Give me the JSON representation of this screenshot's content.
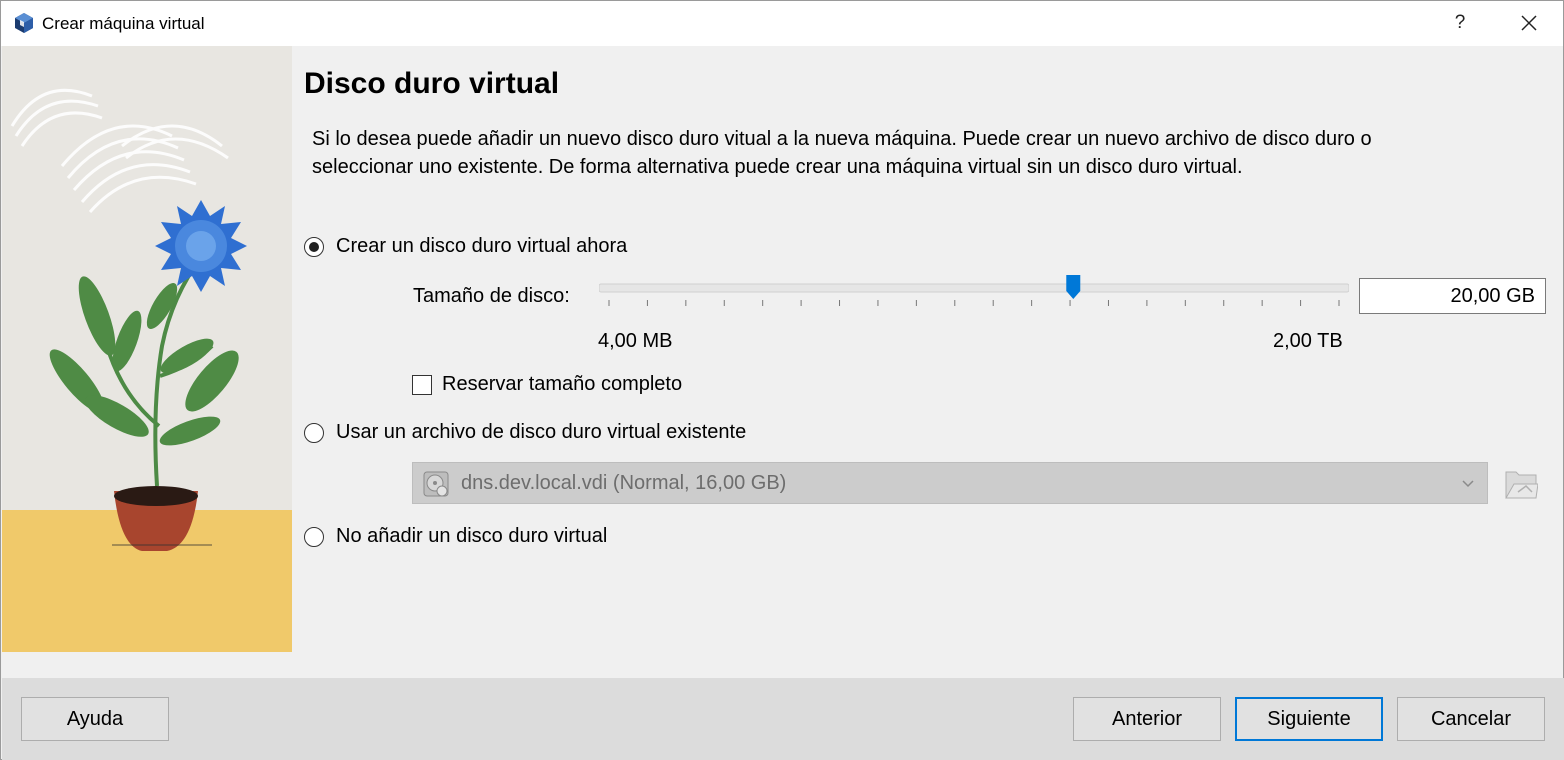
{
  "window": {
    "title": "Crear máquina virtual",
    "help": "?",
    "accent_color": "#0078d7"
  },
  "page": {
    "heading": "Disco duro virtual",
    "description": "Si lo desea puede añadir un nuevo disco duro vitual a la nueva máquina. Puede crear un nuevo archivo de disco duro o seleccionar uno existente. De forma alternativa puede crear una máquina virtual sin un disco duro virtual."
  },
  "options": {
    "create_now": {
      "label": "Crear un disco duro virtual ahora",
      "checked": true
    },
    "use_existing": {
      "label": "Usar un archivo de disco duro virtual existente",
      "checked": false
    },
    "no_disk": {
      "label": "No añadir un disco duro virtual",
      "checked": false
    }
  },
  "disk_size": {
    "label": "Tamaño de disco:",
    "value": "20,00 GB",
    "min_label": "4,00 MB",
    "max_label": "2,00 TB",
    "slider_fraction": 0.636,
    "tick_count": 20
  },
  "reserve": {
    "label": "Reservar tamaño completo",
    "checked": false
  },
  "existing_file": {
    "selected": "dns.dev.local.vdi (Normal, 16,00 GB)",
    "icon": "hard-disk-icon"
  },
  "buttons": {
    "help": "Ayuda",
    "back": "Anterior",
    "next": "Siguiente",
    "cancel": "Cancelar"
  }
}
